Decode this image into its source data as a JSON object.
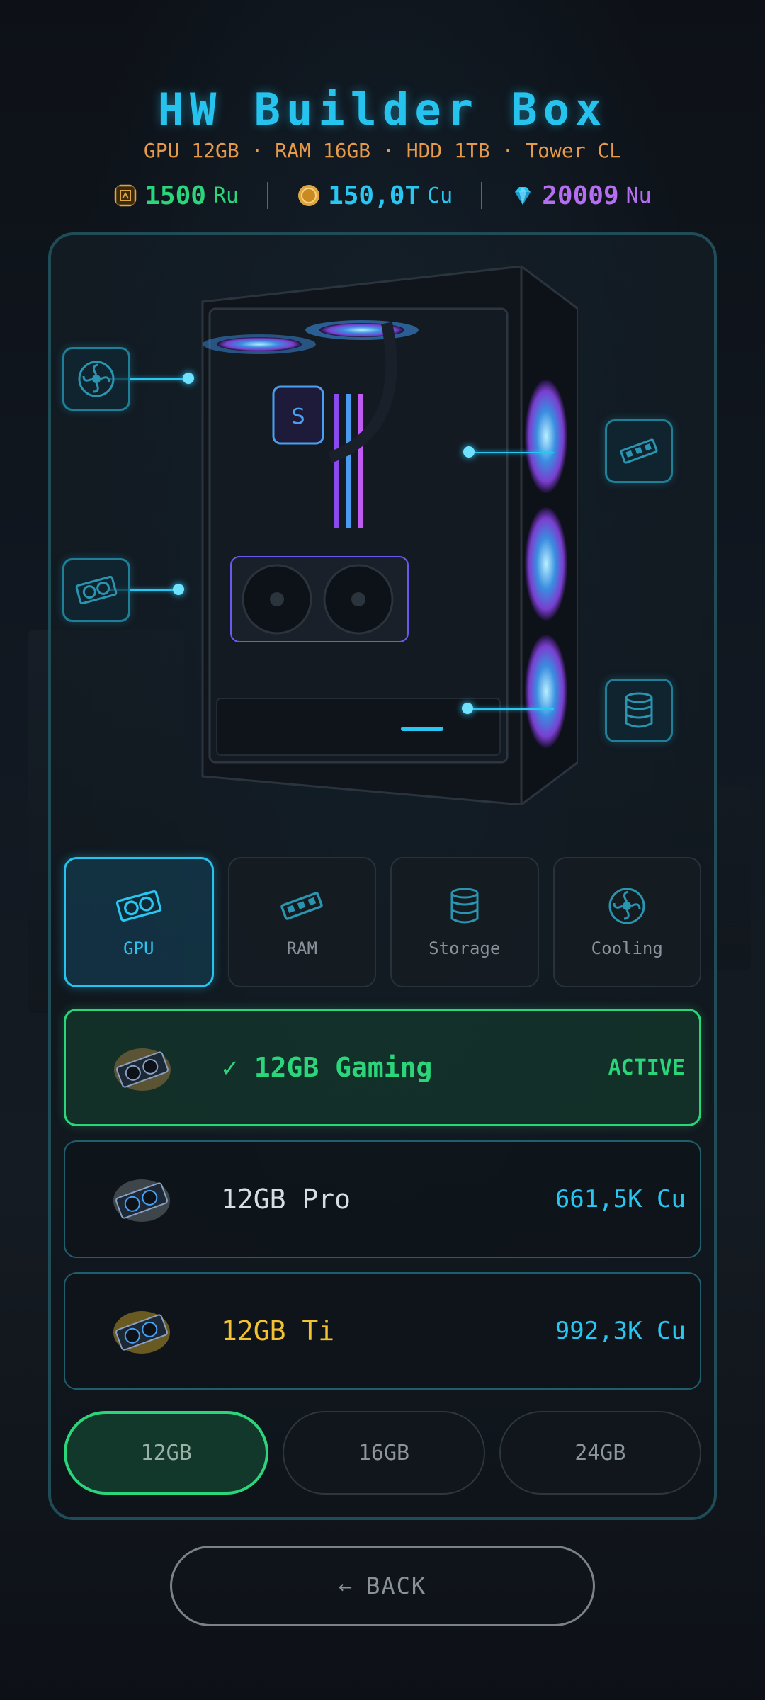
{
  "header": {
    "title": "HW Builder Box",
    "subtitle": "GPU 12GB · RAM 16GB · HDD 1TB · Tower CL"
  },
  "currencies": [
    {
      "icon": "chip-coin-icon",
      "value": "1500",
      "unit": "Ru",
      "color": "#2bd67b"
    },
    {
      "icon": "gold-coin-icon",
      "value": "150,0T",
      "unit": "Cu",
      "color": "#2ac6f2"
    },
    {
      "icon": "diamond-icon",
      "value": "20009",
      "unit": "Nu",
      "color": "#b56ef0"
    }
  ],
  "hotspots": [
    {
      "name": "cooling-hotspot",
      "icon": "fan-icon"
    },
    {
      "name": "ram-hotspot",
      "icon": "ram-icon"
    },
    {
      "name": "gpu-hotspot",
      "icon": "gpu-icon"
    },
    {
      "name": "storage-hotspot",
      "icon": "storage-icon"
    }
  ],
  "tabs": [
    {
      "label": "GPU",
      "icon": "gpu-icon",
      "active": true
    },
    {
      "label": "RAM",
      "icon": "ram-icon",
      "active": false
    },
    {
      "label": "Storage",
      "icon": "storage-icon",
      "active": false
    },
    {
      "label": "Cooling",
      "icon": "fan-icon",
      "active": false
    }
  ],
  "items": [
    {
      "name": "✓ 12GB Gaming",
      "price": "ACTIVE",
      "active": true,
      "name_color": "#2bd67b",
      "glow": "#e69a4a"
    },
    {
      "name": "12GB Pro",
      "price": "661,5K Cu",
      "active": false,
      "name_color": "#d6dde3",
      "glow": "#cfd8e0"
    },
    {
      "name": "12GB Ti",
      "price": "992,3K Cu",
      "active": false,
      "name_color": "#f2c230",
      "glow": "#f2c230"
    }
  ],
  "sizes": [
    {
      "label": "12GB",
      "active": true
    },
    {
      "label": "16GB",
      "active": false
    },
    {
      "label": "24GB",
      "active": false
    }
  ],
  "back": {
    "arrow": "←",
    "label": "BACK"
  },
  "colors": {
    "accent": "#27c3ef",
    "active_green": "#2bd67b",
    "subtitle": "#e69a4a"
  }
}
